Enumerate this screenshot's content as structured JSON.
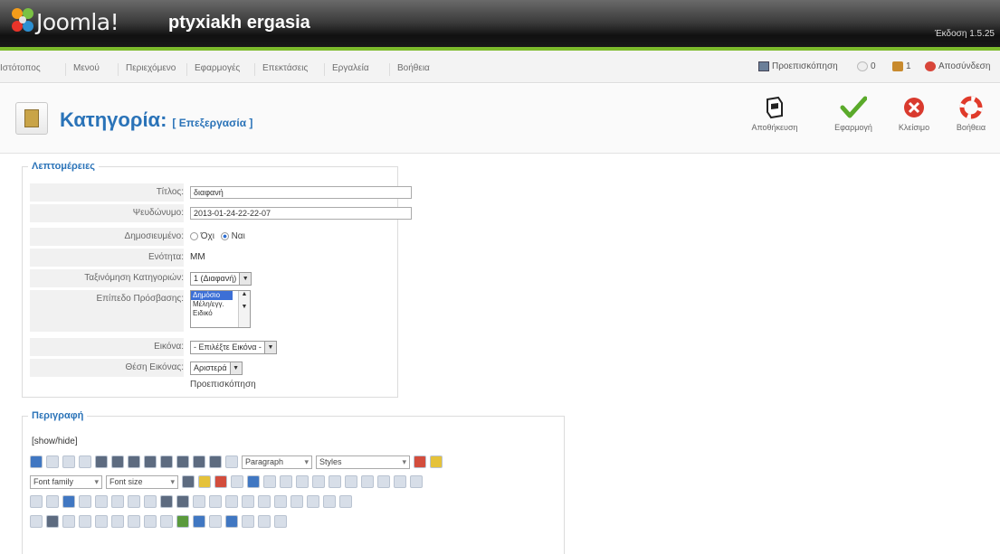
{
  "header": {
    "brand": "Joomla!",
    "site_name": "ptyxiakh ergasia",
    "version": "Έκδοση 1.5.25"
  },
  "menu": [
    "Ιστότοπος",
    "Μενού",
    "Περιεχόμενο",
    "Εφαρμογές",
    "Επεκτάσεις",
    "Εργαλεία",
    "Βοήθεια"
  ],
  "status": {
    "preview": "Προεπισκόπηση",
    "messages": "0",
    "users": "1",
    "logout": "Αποσύνδεση"
  },
  "page": {
    "title": "Κατηγορία:",
    "subtitle": "[ Επεξεργασία ]"
  },
  "toolbar": {
    "save": "Αποθήκευση",
    "apply": "Εφαρμογή",
    "close": "Κλείσιμο",
    "help": "Βοήθεια"
  },
  "params": {
    "legend": "Λεπτομέρειες",
    "title_label": "Τίτλος:",
    "title_value": "διαφανή",
    "alias_label": "Ψευδώνυμο:",
    "alias_value": "2013-01-24-22-22-07",
    "published_label": "Δημοσιευμένο:",
    "no": "Όχι",
    "yes": "Ναι",
    "section_label": "Ενότητα:",
    "section_value": "MM",
    "order_label": "Ταξινόμηση Κατηγοριών:",
    "order_value": "1 (Διαφανή)",
    "access_label": "Επίπεδο Πρόσβασης:",
    "access_options": [
      "Δημόσιο",
      "Μέλη/εγγ.",
      "Ειδικό"
    ],
    "image_label": "Εικόνα:",
    "image_value": "- Επιλέξτε Εικόνα -",
    "image_pos_label": "Θέση Εικόνας:",
    "image_pos_value": "Αριστερά",
    "preview_label": "Προεπισκόπηση"
  },
  "description": {
    "legend": "Περιγραφή",
    "toggle": "[show/hide]",
    "format": "Paragraph",
    "styles": "Styles",
    "font_family": "Font family",
    "font_size": "Font size"
  }
}
